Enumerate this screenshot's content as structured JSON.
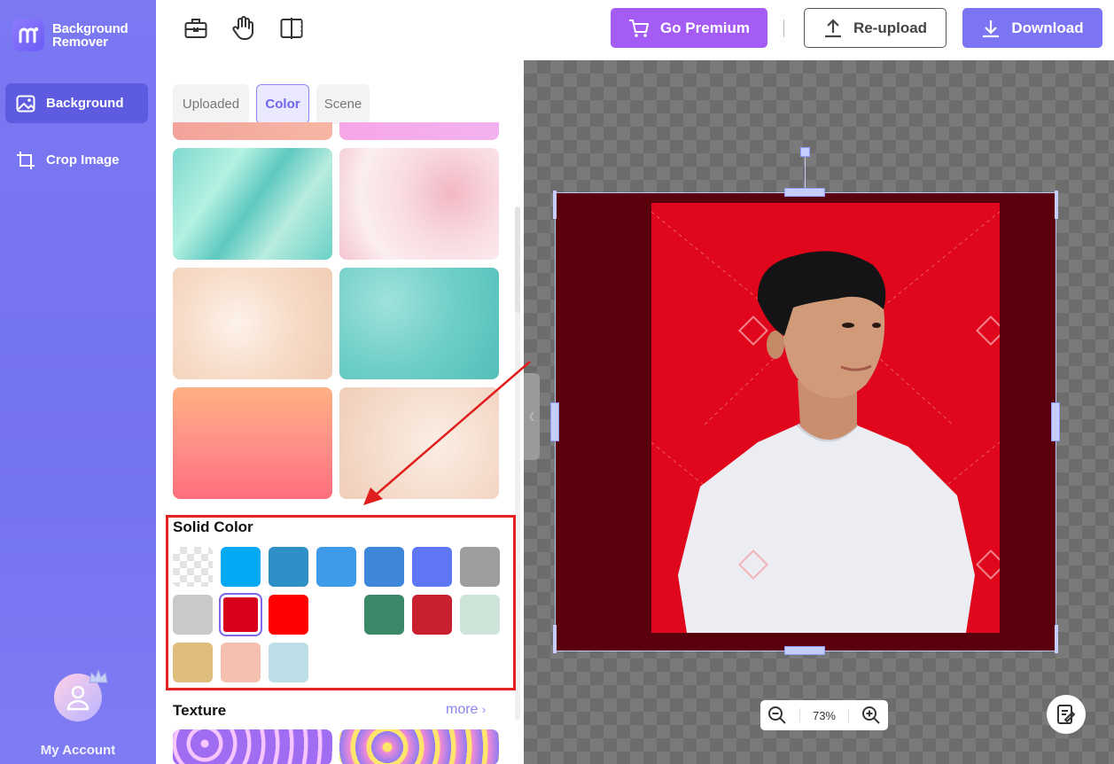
{
  "app": {
    "name_line1": "Background",
    "name_line2": "Remover"
  },
  "sidebar": {
    "items": [
      {
        "label": "Background",
        "icon": "image-icon",
        "active": true
      },
      {
        "label": "Crop Image",
        "icon": "crop-icon",
        "active": false
      }
    ],
    "account_label": "My Account"
  },
  "toolbar": {
    "tools": [
      "briefcase-icon",
      "hand-icon",
      "compare-icon"
    ],
    "premium_label": "Go Premium",
    "reupload_label": "Re-upload",
    "download_label": "Download"
  },
  "panel": {
    "tabs": [
      {
        "label": "Uploaded",
        "active": false
      },
      {
        "label": "Color",
        "active": true
      },
      {
        "label": "Scene",
        "active": false
      }
    ],
    "solid_color_title": "Solid Color",
    "solid_colors": [
      "transparent",
      "#03a9f4",
      "#2f8fc7",
      "#3d9be9",
      "#3d86d9",
      "#6077f5",
      "#9e9e9e",
      "#c9c9c9",
      "#d9001b",
      "#ff0000",
      "#ffffff",
      "#3a8a6a",
      "#c8202f",
      "#cfe4d8",
      "#e0bd7c",
      "#f6c0b0",
      "#bcdfe7"
    ],
    "selected_color": "#d9001b",
    "texture_title": "Texture",
    "more_label": "more"
  },
  "canvas": {
    "zoom": "73%",
    "frame_color": "#5a000d",
    "background_color": "#e0061c"
  }
}
